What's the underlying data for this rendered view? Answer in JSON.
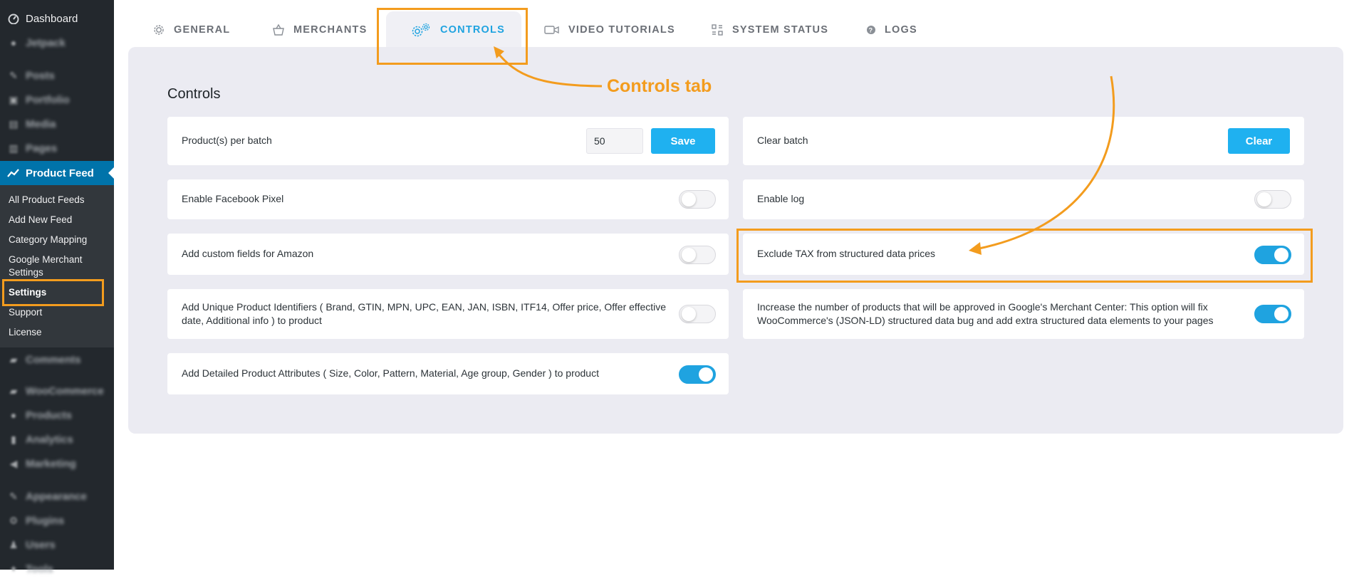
{
  "sidebar": {
    "dashboard": "Dashboard",
    "jetpack": "Jetpack",
    "posts": "Posts",
    "portfolio": "Portfolio",
    "media": "Media",
    "pages": "Pages",
    "product_feed": "Product Feed",
    "submenu": {
      "all_feeds": "All Product Feeds",
      "add_new": "Add New Feed",
      "category_mapping": "Category Mapping",
      "merchant_settings_1": "Google Merchant",
      "merchant_settings_2": "Settings",
      "settings": "Settings",
      "support": "Support",
      "license": "License"
    },
    "comments": "Comments",
    "woocommerce": "WooCommerce",
    "products": "Products",
    "analytics": "Analytics",
    "marketing": "Marketing",
    "appearance": "Appearance",
    "plugins": "Plugins",
    "users": "Users",
    "tools": "Tools"
  },
  "tabs": {
    "general": "GENERAL",
    "merchants": "MERCHANTS",
    "controls": "CONTROLS",
    "video": "VIDEO TUTORIALS",
    "system": "SYSTEM STATUS",
    "logs": "LOGS"
  },
  "panel": {
    "title": "Controls",
    "batch_label": "Product(s) per batch",
    "batch_value": "50",
    "save_label": "Save",
    "clear_batch_label": "Clear batch",
    "clear_label": "Clear",
    "facebook_pixel": "Enable Facebook Pixel",
    "facebook_pixel_on": false,
    "enable_log": "Enable log",
    "enable_log_on": false,
    "amazon_fields": "Add custom fields for Amazon",
    "amazon_fields_on": false,
    "exclude_tax": "Exclude TAX from structured data prices",
    "exclude_tax_on": true,
    "unique_ids_1": "Add Unique Product Identifiers ( Brand, GTIN, MPN, UPC, EAN, JAN, ISBN, ITF14, Offer price, Offer effective",
    "unique_ids_2": "date, Additional info ) to product",
    "unique_ids_on": false,
    "increase_1": "Increase the number of products that will be approved in Google's Merchant Center: This option will fix",
    "increase_2": "WooCommerce's (JSON-LD) structured data bug and add extra structured data elements to your pages",
    "increase_on": true,
    "detailed_attrs": "Add Detailed Product Attributes ( Size, Color, Pattern, Material, Age group, Gender ) to product",
    "detailed_attrs_on": true
  },
  "annotation": {
    "controls_tab": "Controls tab",
    "color": "#f39c1e"
  }
}
